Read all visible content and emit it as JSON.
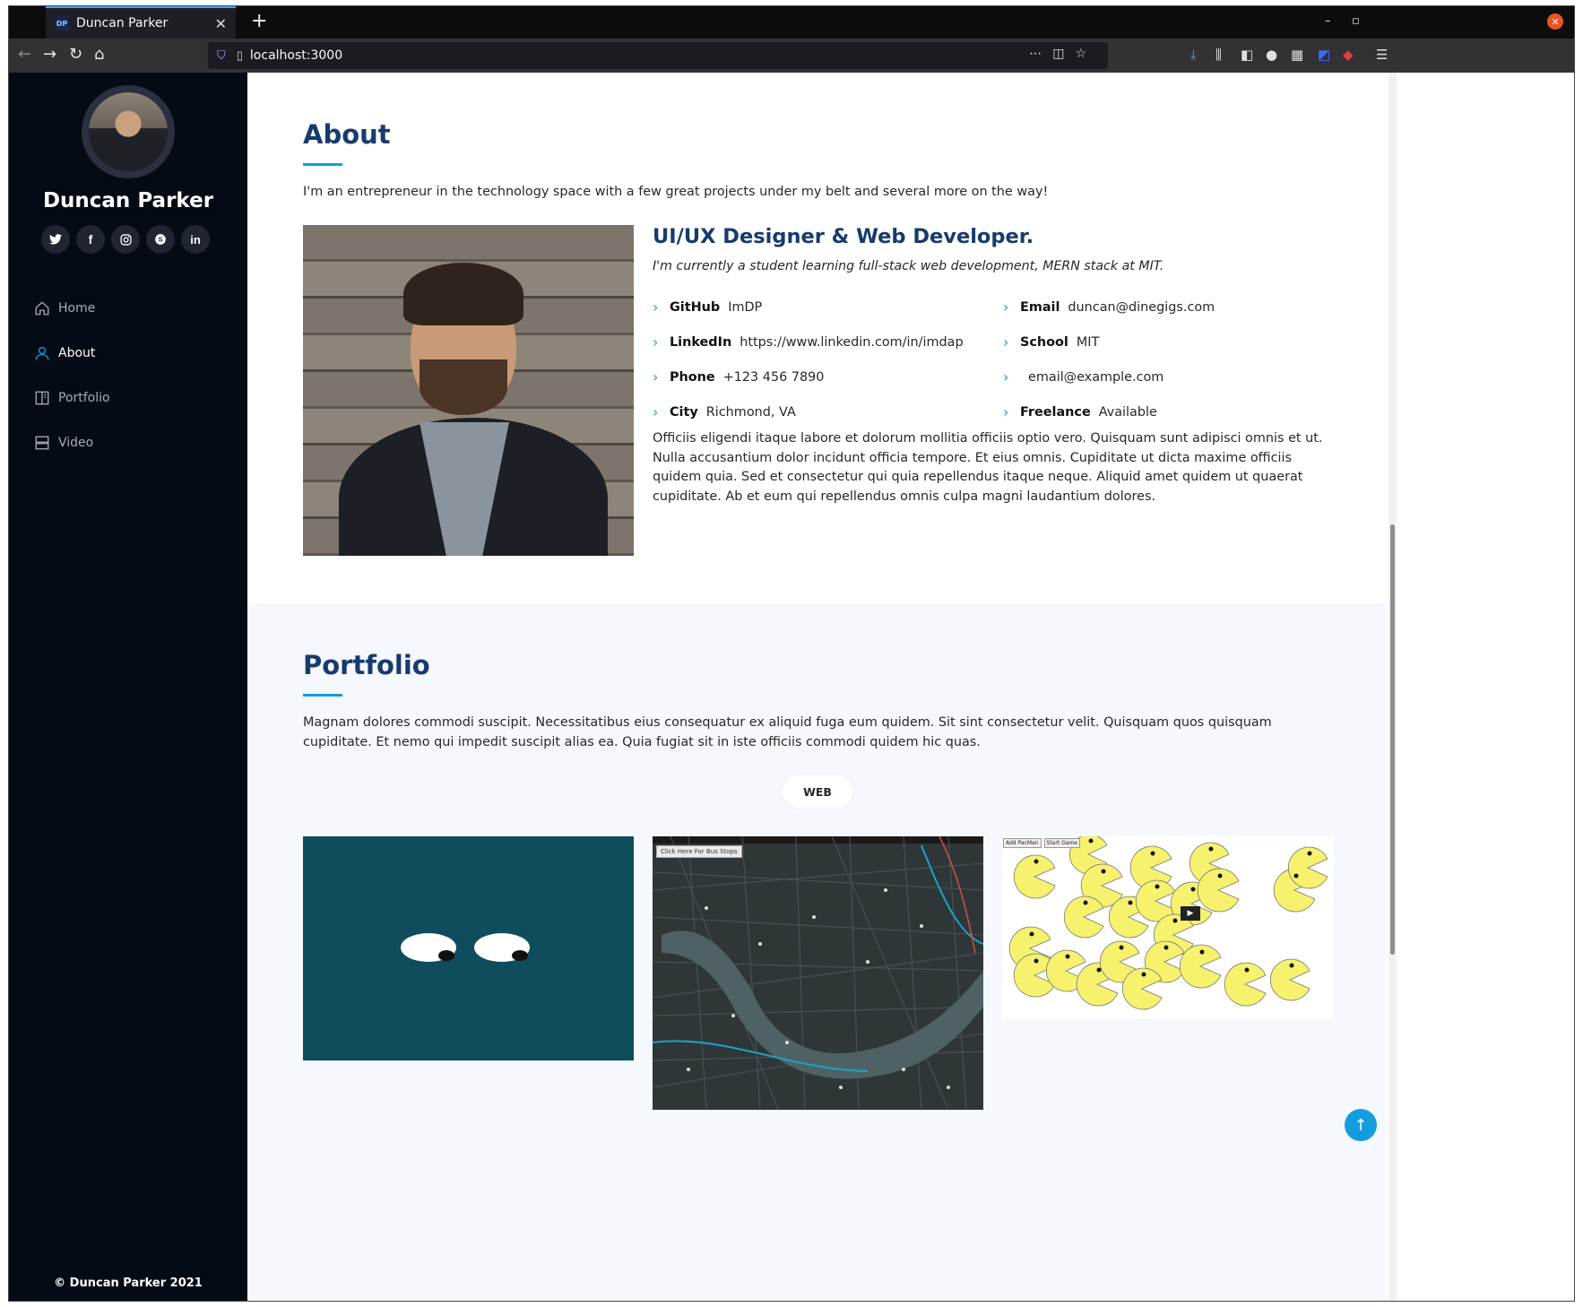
{
  "browser": {
    "tab_title": "Duncan Parker",
    "tab_favicon": "DP",
    "url": "localhost:3000",
    "accent": "#45a1ff"
  },
  "sidebar": {
    "name": "Duncan Parker",
    "socials": [
      {
        "icon": "twitter-icon",
        "glyph": "🐦"
      },
      {
        "icon": "facebook-icon",
        "glyph": "f"
      },
      {
        "icon": "instagram-icon",
        "glyph": "◎"
      },
      {
        "icon": "skype-icon",
        "glyph": "S"
      },
      {
        "icon": "linkedin-icon",
        "glyph": "in"
      }
    ],
    "nav": [
      {
        "label": "Home",
        "icon": "home-icon",
        "active": false
      },
      {
        "label": "About",
        "icon": "person-icon",
        "active": true
      },
      {
        "label": "Portfolio",
        "icon": "book-icon",
        "active": false
      },
      {
        "label": "Video",
        "icon": "server-icon",
        "active": false
      }
    ],
    "footer": "© Duncan Parker 2021"
  },
  "about": {
    "title": "About",
    "intro": "I'm an entrepreneur in the technology space with a few great projects under my belt and several more on the way!",
    "role": "UI/UX Designer & Web Developer.",
    "tagline": "I'm currently a student learning full-stack web development, MERN stack at MIT.",
    "facts_left": [
      {
        "label": "GitHub",
        "value": "ImDP"
      },
      {
        "label": "LinkedIn",
        "value": "https://www.linkedin.com/in/imdap"
      },
      {
        "label": "Phone",
        "value": "+123 456 7890"
      },
      {
        "label": "City",
        "value": "Richmond, VA"
      }
    ],
    "facts_right": [
      {
        "label": "Email",
        "value": "duncan@dinegigs.com"
      },
      {
        "label": "School",
        "value": "MIT"
      },
      {
        "label": "",
        "value": "email@example.com"
      },
      {
        "label": "Freelance",
        "value": "Available"
      }
    ],
    "description": "Officiis eligendi itaque labore et dolorum mollitia officiis optio vero. Quisquam sunt adipisci omnis et ut. Nulla accusantium dolor incidunt officia tempore. Et eius omnis. Cupiditate ut dicta maxime officiis quidem quia. Sed et consectetur qui quia repellendus itaque neque. Aliquid amet quidem ut quaerat cupiditate. Ab et eum qui repellendus omnis culpa magni laudantium dolores."
  },
  "portfolio": {
    "title": "Portfolio",
    "description": "Magnam dolores commodi suscipit. Necessitatibus eius consequatur ex aliquid fuga eum quidem. Sit sint consectetur velit. Quisquam quos quisquam cupiditate. Et nemo qui impedit suscipit alias ea. Quia fugiat sit in iste officiis commodi quidem hic quas.",
    "filter_label": "WEB",
    "map_button": "Click Here For Bus Stops",
    "pacman_buttons": [
      "Add PacMan",
      "Start Game"
    ]
  },
  "colors": {
    "sidebar_bg": "#040b14",
    "heading": "#173b6c",
    "accent": "#149ddd"
  }
}
